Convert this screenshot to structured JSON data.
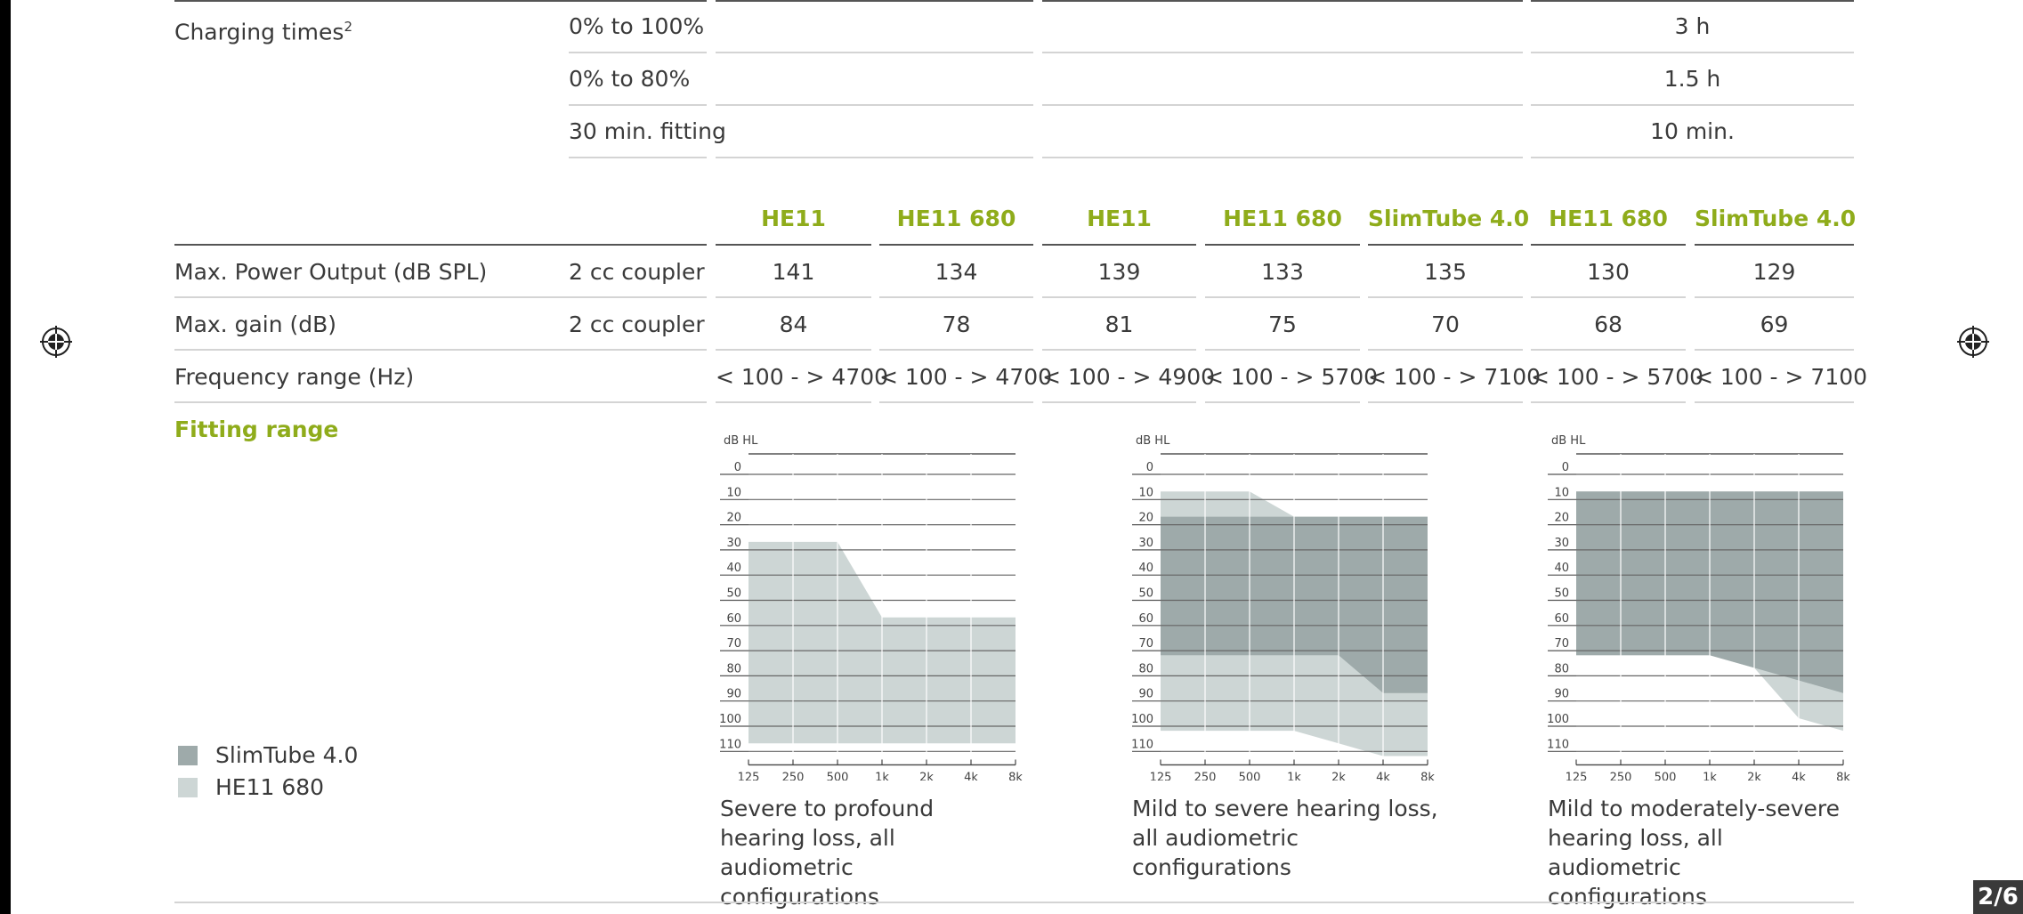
{
  "charging": {
    "label": "Charging times",
    "sup": "2",
    "rows": [
      {
        "label": "0% to 100%",
        "value": "3 h"
      },
      {
        "label": "0% to 80%",
        "value": "1.5 h"
      },
      {
        "label": "30 min. fitting",
        "value": "10 min."
      }
    ]
  },
  "columns": [
    "HE11",
    "HE11 680",
    "HE11",
    "HE11 680",
    "SlimTube 4.0",
    "HE11 680",
    "SlimTube 4.0"
  ],
  "specs": [
    {
      "label": "Max. Power Output (dB SPL)",
      "sub": "2 cc coupler",
      "values": [
        "141",
        "134",
        "139",
        "133",
        "135",
        "130",
        "129"
      ]
    },
    {
      "label": "Max. gain (dB)",
      "sub": "2 cc coupler",
      "values": [
        "84",
        "78",
        "81",
        "75",
        "70",
        "68",
        "69"
      ]
    },
    {
      "label": "Frequency range (Hz)",
      "sub": "",
      "values": [
        "< 100 - > 4700",
        "< 100 - > 4700",
        "< 100 - > 4900",
        "< 100 - > 5700",
        "< 100 - > 7100",
        "< 100 - > 5700",
        "< 100 - > 7100"
      ]
    }
  ],
  "fitting": {
    "title": "Fitting range",
    "unit": "dB HL",
    "y_ticks": [
      "0",
      "10",
      "20",
      "30",
      "40",
      "50",
      "60",
      "70",
      "80",
      "90",
      "100",
      "110"
    ],
    "x_ticks": [
      "125",
      "250",
      "500",
      "1k",
      "2k",
      "4k",
      "8k"
    ],
    "legend": [
      {
        "label": "SlimTube 4.0",
        "color": "#9eaaaa"
      },
      {
        "label": "HE11 680",
        "color": "#cdd6d5"
      }
    ],
    "captions": [
      "Severe to profound hearing loss, all audiometric configurations",
      "Mild to severe hearing loss, all audiometric configurations",
      "Mild to moderately-severe hearing loss, all audiometric configurations"
    ]
  },
  "chart_data": [
    {
      "type": "area",
      "x": [
        "125",
        "250",
        "500",
        "1k",
        "2k",
        "4k",
        "8k"
      ],
      "ylabel": "dB HL",
      "ylim": [
        0,
        110
      ],
      "y_inverted": true,
      "series": [
        {
          "name": "HE11 680",
          "top": [
            30,
            30,
            30,
            60,
            60,
            60,
            60
          ],
          "bottom": [
            110,
            110,
            110,
            110,
            110,
            110,
            110
          ],
          "color": "#cdd6d5"
        }
      ]
    },
    {
      "type": "area",
      "x": [
        "125",
        "250",
        "500",
        "1k",
        "2k",
        "4k",
        "8k"
      ],
      "ylabel": "dB HL",
      "ylim": [
        0,
        110
      ],
      "y_inverted": true,
      "series": [
        {
          "name": "HE11 680",
          "top": [
            10,
            10,
            10,
            20,
            20,
            20,
            20
          ],
          "bottom": [
            105,
            105,
            105,
            105,
            110,
            115,
            115
          ],
          "color": "#cdd6d5"
        },
        {
          "name": "SlimTube 4.0",
          "top": [
            20,
            20,
            20,
            20,
            20,
            20,
            20
          ],
          "bottom": [
            75,
            75,
            75,
            75,
            75,
            90,
            90
          ],
          "color": "#9eaaaa"
        }
      ]
    },
    {
      "type": "area",
      "x": [
        "125",
        "250",
        "500",
        "1k",
        "2k",
        "4k",
        "8k"
      ],
      "ylabel": "dB HL",
      "ylim": [
        0,
        110
      ],
      "y_inverted": true,
      "series": [
        {
          "name": "HE11 680",
          "top": [
            10,
            10,
            10,
            10,
            10,
            10,
            10
          ],
          "bottom": [
            75,
            75,
            75,
            75,
            80,
            100,
            105
          ],
          "color": "#cdd6d5"
        },
        {
          "name": "SlimTube 4.0",
          "top": [
            10,
            10,
            10,
            10,
            10,
            10,
            10
          ],
          "bottom": [
            75,
            75,
            75,
            75,
            80,
            85,
            90
          ],
          "color": "#9eaaaa"
        }
      ]
    }
  ],
  "page": {
    "number": "2/6"
  }
}
